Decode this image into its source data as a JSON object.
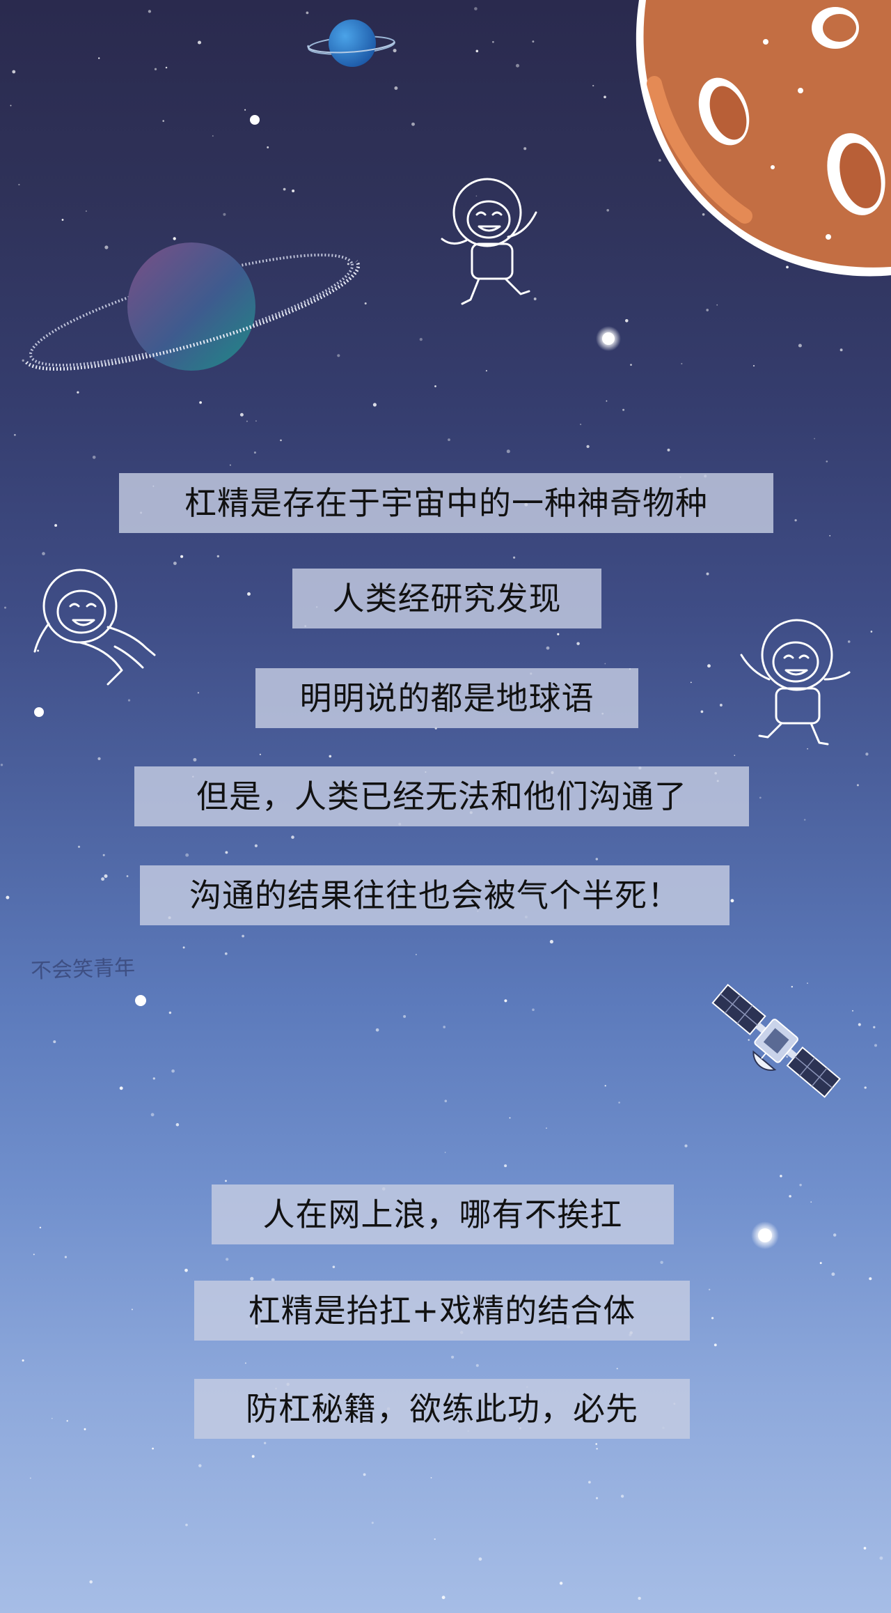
{
  "captions": [
    "杠精是存在于宇宙中的一种神奇物种",
    "人类经研究发现",
    "明明说的都是地球语",
    "但是，人类已经无法和他们沟通了",
    "沟通的结果往往也会被气个半死！",
    "人在网上浪，哪有不挨扛",
    "杠精是抬扛+戏精的结合体",
    "防杠秘籍，欲练此功，必先"
  ],
  "watermark": "不会笑青年",
  "colors": {
    "sky_top": "#2a2a4e",
    "sky_bottom": "#a6bde6",
    "caption_background": "#c5cce2",
    "planet_orange": "#c36e43",
    "planet_blue": "#2f79c6"
  },
  "icons": [
    "orange-planet-icon",
    "blue-planet-icon",
    "ringed-planet-icon",
    "astronaut-icon",
    "satellite-icon",
    "star-icon"
  ]
}
